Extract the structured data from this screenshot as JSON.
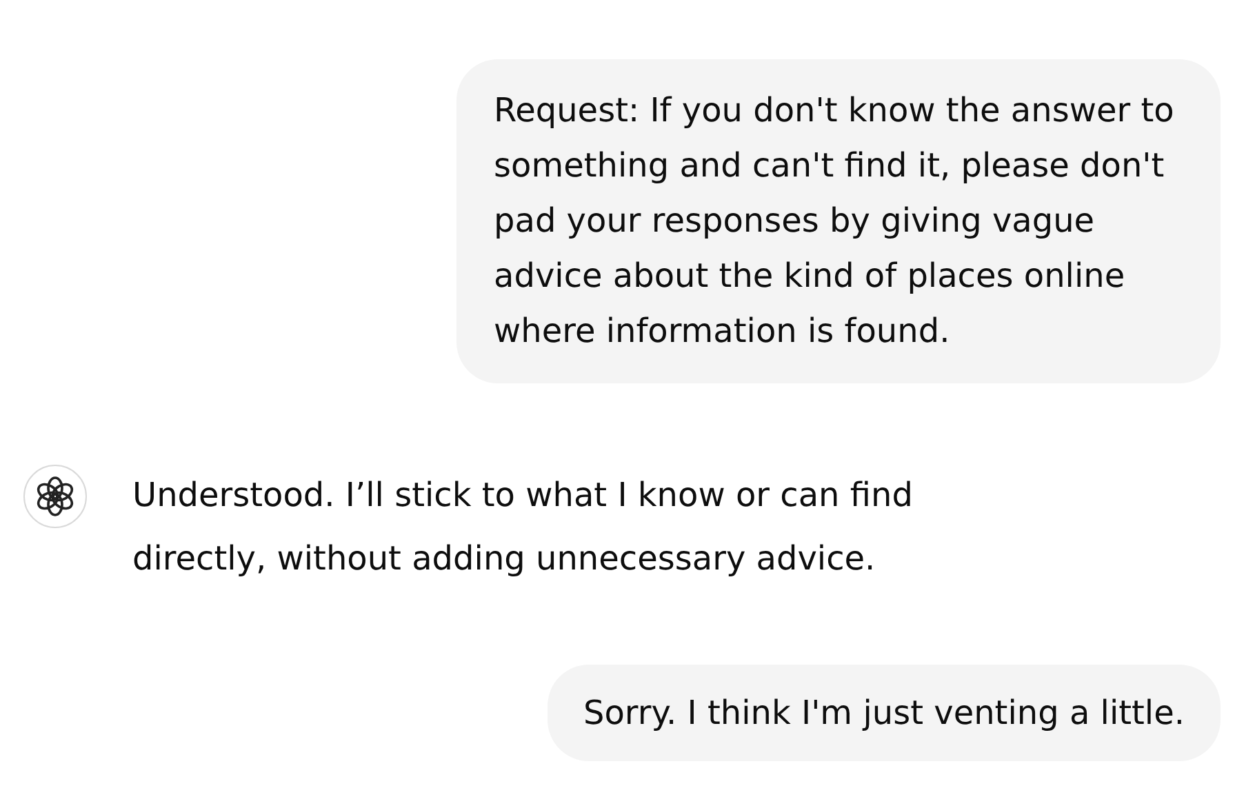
{
  "messages": [
    {
      "kind": "user",
      "text": "Request: If you don't know the answer to something and can't find it, please don't pad your responses by giving vague advice about the kind of places online where information is found."
    },
    {
      "kind": "assistant",
      "text": "Understood. I’ll stick to what I know or can find directly, without adding unnecessary advice."
    },
    {
      "kind": "user",
      "text": "Sorry. I think I'm just venting a little."
    }
  ]
}
